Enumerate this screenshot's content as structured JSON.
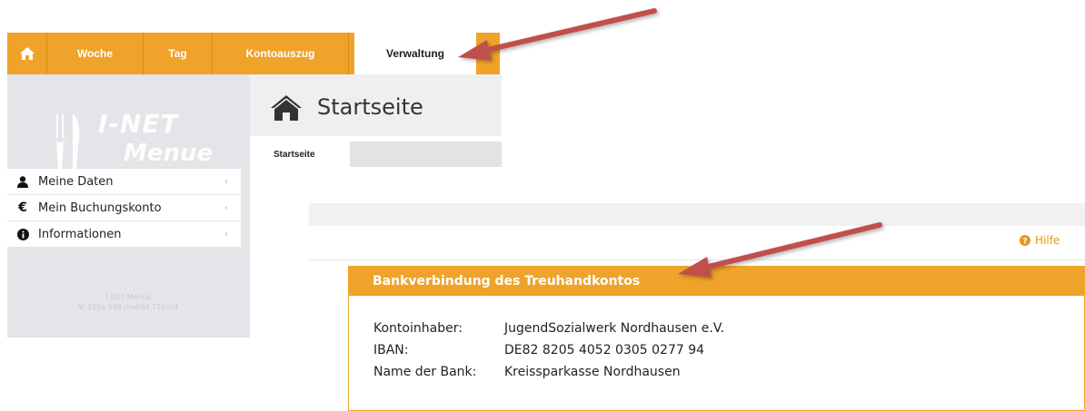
{
  "nav": {
    "home_icon": "home-icon",
    "tabs": [
      {
        "label": "Woche"
      },
      {
        "label": "Tag"
      },
      {
        "label": "Kontoauszug"
      },
      {
        "label": "Verwaltung",
        "active": true
      }
    ]
  },
  "sidebar": {
    "logo_line1": "I-NET",
    "logo_line2": "Menue",
    "items": [
      {
        "label": "Meine Daten",
        "icon": "user-icon"
      },
      {
        "label": "Mein Buchungskonto",
        "icon": "euro-icon"
      },
      {
        "label": "Informationen",
        "icon": "info-icon"
      }
    ],
    "footer_line1": "I-NET-Menue",
    "footer_line2": "V. 150x 598 ma604 710xz4"
  },
  "page": {
    "title": "Startseite",
    "breadcrumb": "Startseite",
    "help_label": "Hilfe"
  },
  "bank": {
    "title": "Bankverbindung des Treuhandkontos",
    "rows": [
      {
        "label": "Kontoinhaber:",
        "value": "JugendSozialwerk Nordhausen e.V."
      },
      {
        "label": "IBAN:",
        "value": "DE82 8205 4052 0305 0277 94"
      },
      {
        "label": "Name der Bank:",
        "value": "Kreissparkasse Nordhausen"
      }
    ]
  },
  "colors": {
    "accent": "#f0a32a",
    "sidebar_bg": "#e3e5e8",
    "arrow": "#c0504d"
  }
}
